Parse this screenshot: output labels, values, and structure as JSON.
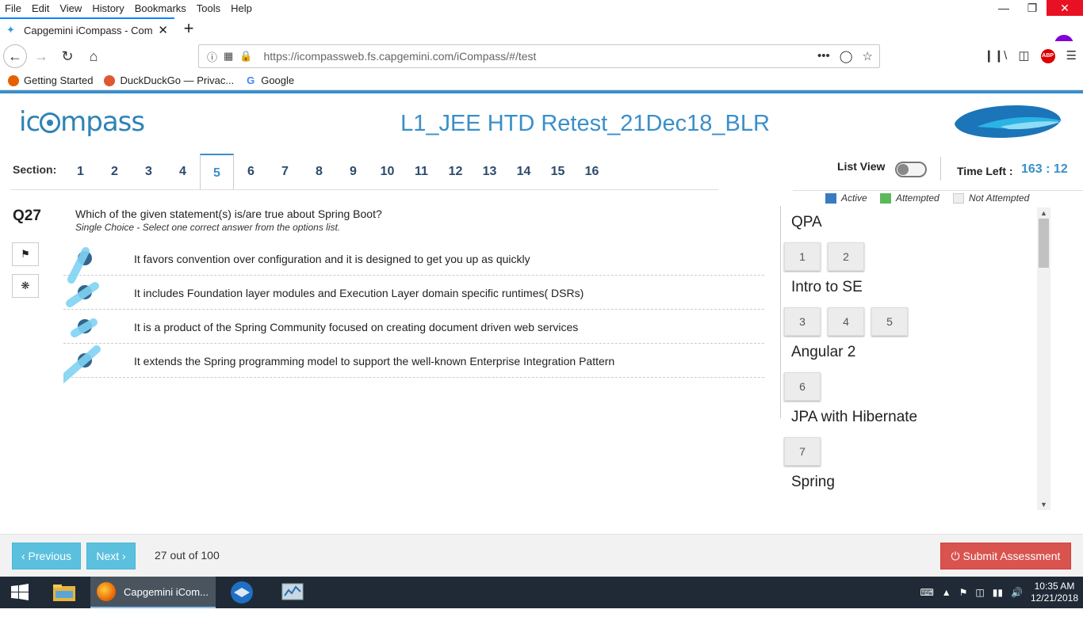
{
  "browser": {
    "menu": [
      "File",
      "Edit",
      "View",
      "History",
      "Bookmarks",
      "Tools",
      "Help"
    ],
    "tab_title": "Capgemini iCompass - Compe",
    "url": "https://icompassweb.fs.capgemini.com/iCompass/#/test",
    "bookmarks": [
      "Getting Started",
      "DuckDuckGo — Privac...",
      "Google"
    ]
  },
  "app": {
    "logo_text_pre": "ic",
    "logo_text_post": "mpass",
    "test_title": "L1_JEE HTD Retest_21Dec18_BLR",
    "section_label": "Section:",
    "sections": [
      "1",
      "2",
      "3",
      "4",
      "5",
      "6",
      "7",
      "8",
      "9",
      "10",
      "11",
      "12",
      "13",
      "14",
      "15",
      "16"
    ],
    "active_section": "5",
    "list_view_label": "List View",
    "time_left_label": "Time Left :",
    "time_left_value": "163 : 12"
  },
  "question": {
    "number": "Q27",
    "text": "Which of the given statement(s) is/are true about Spring Boot?",
    "subtitle": "Single Choice - Select one correct answer from the options list.",
    "options": [
      "It favors convention over configuration and it is designed to get you up as quickly",
      "It includes Foundation layer modules and Execution Layer domain specific runtimes( DSRs)",
      "It is a product of the Spring Community focused on creating document driven web services",
      "It extends the Spring programming model to support the well-known Enterprise Integration Pattern"
    ]
  },
  "legend": {
    "active": "Active",
    "attempted": "Attempted",
    "not_attempted": "Not Attempted",
    "colors": {
      "active": "#3a7ac1",
      "attempted": "#5cb85c",
      "not_attempted": "#eeeeee"
    }
  },
  "palette": {
    "groups": [
      {
        "title": "QPA",
        "questions": [
          "1",
          "2"
        ]
      },
      {
        "title": "Intro to SE",
        "questions": [
          "3",
          "4",
          "5"
        ]
      },
      {
        "title": "Angular 2",
        "questions": [
          "6"
        ]
      },
      {
        "title": "JPA with Hibernate",
        "questions": [
          "7"
        ]
      },
      {
        "title": "Spring",
        "questions": []
      }
    ]
  },
  "footer": {
    "previous_label": "‹ Previous",
    "next_label": "Next ›",
    "progress": "27 out of 100",
    "submit_label": "⏻ Submit Assessment"
  },
  "taskbar": {
    "active_app": "Capgemini iCom...",
    "time": "10:35 AM",
    "date": "12/21/2018"
  }
}
